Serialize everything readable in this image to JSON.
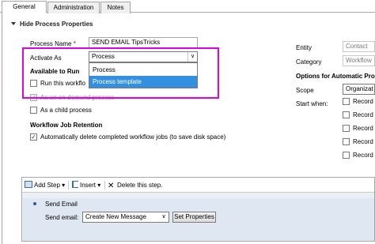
{
  "tabs": [
    {
      "label": "General"
    },
    {
      "label": "Administration"
    },
    {
      "label": "Notes"
    }
  ],
  "section": {
    "title": "Hide Process Properties"
  },
  "form": {
    "process_name_label": "Process Name",
    "required_marker": "*",
    "process_name_value": "SEND EMAIL TipsTricks",
    "activate_as_label": "Activate As",
    "activate_as_value": "Process",
    "activate_as_options": [
      "Process",
      "Process template"
    ],
    "available_to_run_label": "Available to Run",
    "run_workflow_label": "Run this workflo",
    "on_demand_label": "As an on-demand process",
    "child_process_label": "As a child process",
    "retention_label": "Workflow Job Retention",
    "auto_delete_label": "Automatically delete completed workflow jobs (to save disk space)"
  },
  "right": {
    "entity_label": "Entity",
    "entity_value": "Contact",
    "category_label": "Category",
    "category_value": "Workflow",
    "options_label": "Options for Automatic Proc",
    "scope_label": "Scope",
    "scope_value": "Organizat",
    "start_when_label": "Start when:",
    "record_label": "Record"
  },
  "steps": {
    "add_step": "Add Step",
    "insert": "Insert",
    "delete": "Delete this step.",
    "step_name": "Send Email",
    "send_email_label": "Send email:",
    "send_email_value": "Create New Message",
    "set_properties": "Set Properties"
  },
  "colors": {
    "highlight": "#e400e4",
    "selected_option": "#3390e0"
  }
}
